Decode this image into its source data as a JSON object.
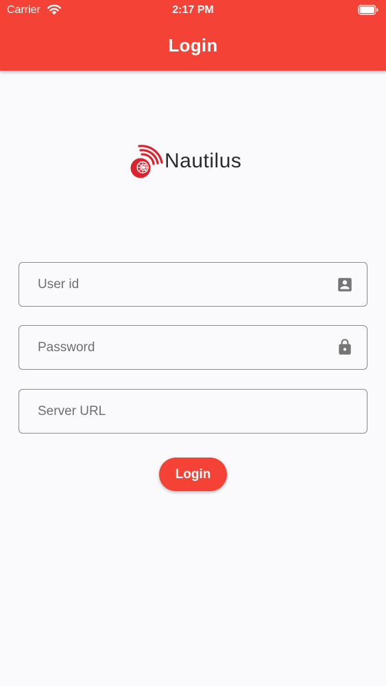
{
  "status_bar": {
    "carrier": "Carrier",
    "time": "2:17 PM",
    "wifi_icon": "wifi-icon",
    "battery_icon": "battery-icon"
  },
  "app_bar": {
    "title": "Login",
    "color": "#f44336"
  },
  "logo": {
    "text": "Nautilus",
    "icon": "nautilus-shell-icon",
    "color": "#d9232e"
  },
  "form": {
    "user_id": {
      "placeholder": "User id",
      "value": "",
      "icon": "account-box-icon"
    },
    "password": {
      "placeholder": "Password",
      "value": "",
      "icon": "lock-icon"
    },
    "server_url": {
      "placeholder": "Server URL",
      "value": ""
    }
  },
  "login_button": {
    "label": "Login",
    "color": "#f44336"
  }
}
